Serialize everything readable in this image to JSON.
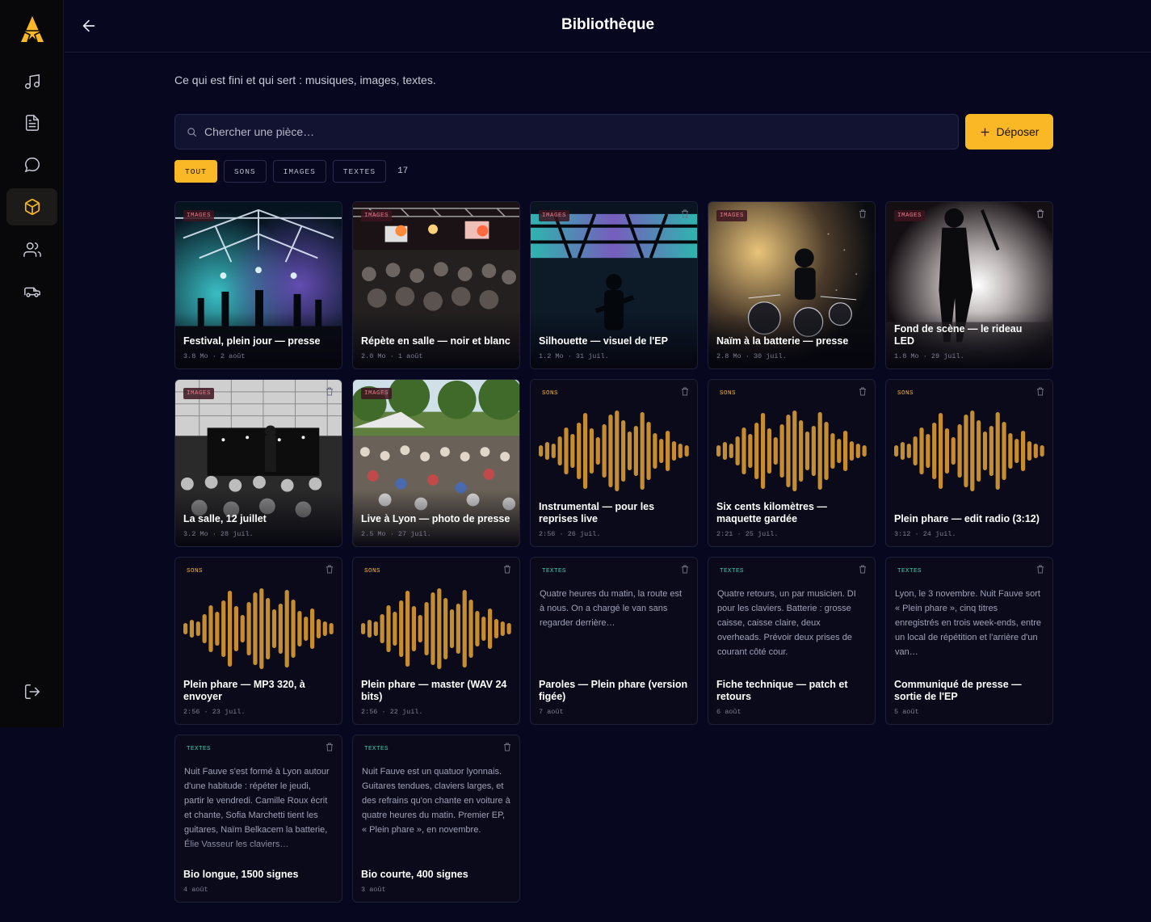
{
  "header": {
    "title": "Bibliothèque"
  },
  "subtitle": "Ce qui est fini et qui sert : musiques, images, textes.",
  "search": {
    "placeholder": "Chercher une pièce…"
  },
  "upload_label": "Déposer",
  "filters": {
    "all": "TOUT",
    "sounds": "SONS",
    "images": "IMAGES",
    "texts": "TEXTES",
    "count": "17"
  },
  "colors": {
    "accent": "#fbb826",
    "background": "#070820",
    "sound": "#c58d2f",
    "text_tag": "#3ed1b3",
    "image_tag": "#f07a8a"
  },
  "sidebar": {
    "items": [
      {
        "icon": "music-note-icon",
        "active": false
      },
      {
        "icon": "document-icon",
        "active": false
      },
      {
        "icon": "chat-bubble-icon",
        "active": false
      },
      {
        "icon": "package-icon",
        "active": true
      },
      {
        "icon": "users-icon",
        "active": false
      },
      {
        "icon": "van-icon",
        "active": false
      }
    ],
    "logout_icon": "logout-icon"
  },
  "items": [
    {
      "type": "IMAGES",
      "title": "Festival, plein jour — presse",
      "meta": "3.8 Mo · 2 août"
    },
    {
      "type": "IMAGES",
      "title": "Répète en salle — noir et blanc",
      "meta": "2.0 Mo · 1 août"
    },
    {
      "type": "IMAGES",
      "title": "Silhouette — visuel de l'EP",
      "meta": "1.2 Mo · 31 juil."
    },
    {
      "type": "IMAGES",
      "title": "Naïm à la batterie — presse",
      "meta": "2.8 Mo · 30 juil."
    },
    {
      "type": "IMAGES",
      "title": "Fond de scène — le rideau LED",
      "meta": "1.8 Mo · 29 juil."
    },
    {
      "type": "IMAGES",
      "title": "La salle, 12 juillet",
      "meta": "3.2 Mo · 28 juil."
    },
    {
      "type": "IMAGES",
      "title": "Live à Lyon — photo de presse",
      "meta": "2.5 Mo · 27 juil."
    },
    {
      "type": "SONS",
      "title": "Instrumental — pour les reprises live",
      "meta": "2:56 · 26 juil."
    },
    {
      "type": "SONS",
      "title": "Six cents kilomètres — maquette gardée",
      "meta": "2:21 · 25 juil."
    },
    {
      "type": "SONS",
      "title": "Plein phare — edit radio (3:12)",
      "meta": "3:12 · 24 juil."
    },
    {
      "type": "SONS",
      "title": "Plein phare — MP3 320, à envoyer",
      "meta": "2:56 · 23 juil."
    },
    {
      "type": "SONS",
      "title": "Plein phare — master (WAV 24 bits)",
      "meta": "2:56 · 22 juil."
    },
    {
      "type": "TEXTES",
      "title": "Paroles — Plein phare (version figée)",
      "meta": "7 août",
      "excerpt": "Quatre heures du matin, la route est à nous. On a chargé le van sans regarder derrière…"
    },
    {
      "type": "TEXTES",
      "title": "Fiche technique — patch et retours",
      "meta": "6 août",
      "excerpt": "Quatre retours, un par musicien. DI pour les claviers. Batterie : grosse caisse, caisse claire, deux overheads. Prévoir deux prises de courant côté cour."
    },
    {
      "type": "TEXTES",
      "title": "Communiqué de presse — sortie de l'EP",
      "meta": "5 août",
      "excerpt": "Lyon, le 3 novembre. Nuit Fauve sort « Plein phare », cinq titres enregistrés en trois week-ends, entre un local de répétition et l'arrière d'un van…"
    },
    {
      "type": "TEXTES",
      "title": "Bio longue, 1500 signes",
      "meta": "4 août",
      "excerpt": "Nuit Fauve s'est formé à Lyon autour d'une habitude : répéter le jeudi, partir le vendredi. Camille Roux écrit et chante, Sofia Marchetti tient les guitares, Naïm Belkacem la batterie, Élie Vasseur les claviers…"
    },
    {
      "type": "TEXTES",
      "title": "Bio courte, 400 signes",
      "meta": "3 août",
      "excerpt": "Nuit Fauve est un quatuor lyonnais. Guitares tendues, claviers larges, et des refrains qu'on chante en voiture à quatre heures du matin. Premier EP, « Plein phare », en novembre."
    }
  ]
}
